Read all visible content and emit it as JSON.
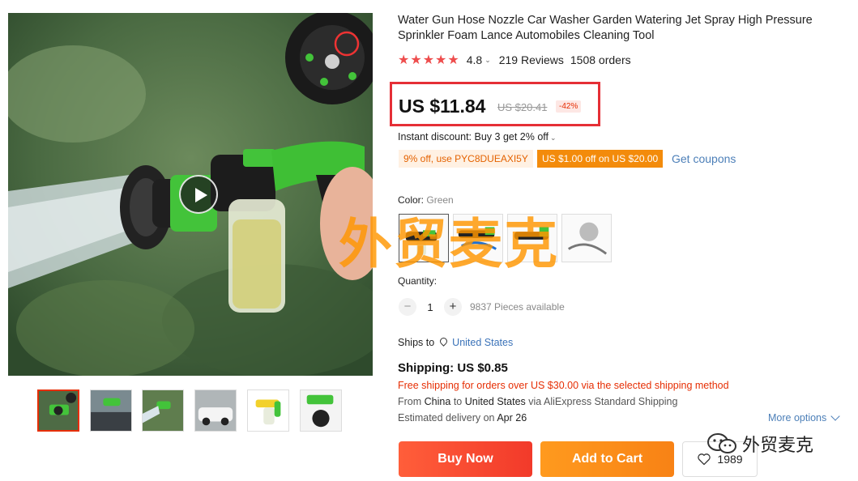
{
  "product": {
    "title": "Water Gun Hose Nozzle Car Washer Garden Watering Jet Spray High Pressure Sprinkler Foam Lance Automobiles Cleaning Tool",
    "rating": "4.8",
    "rating_value": 4.8,
    "reviews": "219 Reviews",
    "orders": "1508 orders"
  },
  "price": {
    "current": "US $11.84",
    "original": "US $20.41",
    "discount": "-42%",
    "highlight_color": "#e52f36"
  },
  "promotions": {
    "instant_discount": "Instant discount: Buy 3 get 2% off",
    "coupon_code_label": "9% off, use PYC8DUEAXI5Y",
    "coupon_store_label": "US $1.00 off on US $20.00",
    "get_coupons": "Get coupons"
  },
  "color": {
    "label": "Color:",
    "selected": "Green",
    "options": [
      "green-nozzle",
      "blue-nozzle-hose",
      "dark-nozzle",
      "hose-kit"
    ]
  },
  "quantity": {
    "label": "Quantity:",
    "value": "1",
    "available": "9837 Pieces available",
    "minus": "−",
    "plus": "+"
  },
  "shipping": {
    "ships_to_label": "Ships to",
    "country": "United States",
    "cost": "Shipping: US $0.85",
    "free_note": "Free shipping for orders over US $30.00 via the selected shipping method",
    "from_prefix": "From",
    "from_country": "China",
    "to_word": "to",
    "to_country": "United States",
    "via_text": "via AliExpress Standard Shipping",
    "estimated_label": "Estimated delivery on",
    "estimated_date": "Apr 26",
    "more_options": "More options"
  },
  "actions": {
    "buy_now": "Buy Now",
    "add_to_cart": "Add to Cart",
    "wishlist_count": "1989"
  },
  "gallery": {
    "thumbnails": [
      "nozzle-hand",
      "car-wash-spray",
      "garden-watering",
      "car-cleaning",
      "nozzle-product",
      "nozzle-kit"
    ],
    "active_index": 0
  },
  "watermarks": {
    "overlay": "外贸麦克",
    "wechat": "外贸麦克"
  }
}
